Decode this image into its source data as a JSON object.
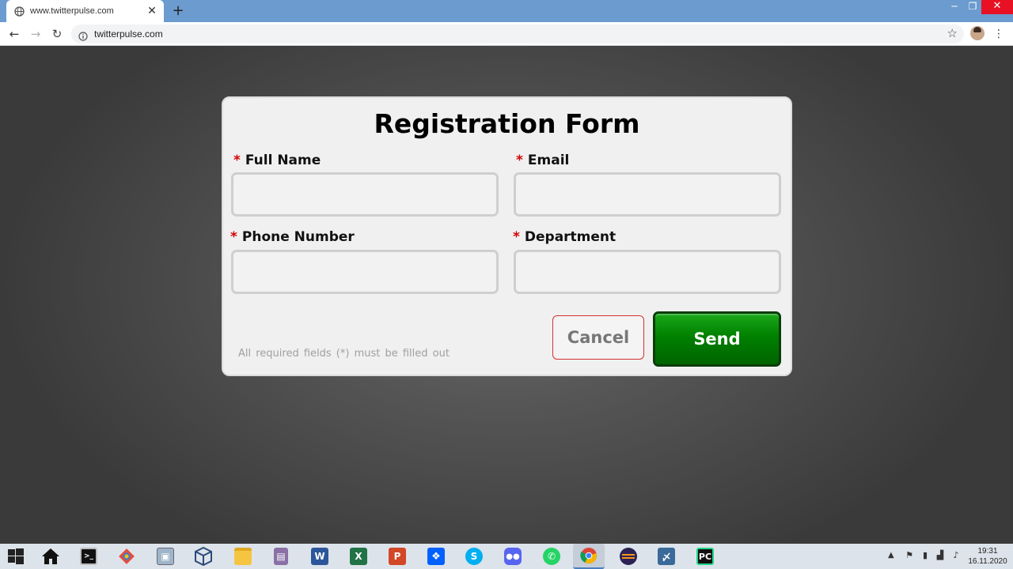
{
  "browser": {
    "tab_title": "www.twitterpulse.com",
    "new_tab_glyph": "+",
    "url": "twitterpulse.com"
  },
  "form": {
    "title": "Registration Form",
    "required_marker": "*",
    "fields": {
      "full_name": {
        "label": "Full  Name",
        "value": ""
      },
      "email": {
        "label": "Email",
        "value": ""
      },
      "phone": {
        "label": "Phone Number",
        "value": ""
      },
      "department": {
        "label": "Department",
        "value": ""
      }
    },
    "note": "All required  fields  (*) must  be  filled  out",
    "cancel_label": "Cancel",
    "send_label": "Send"
  },
  "taskbar": {
    "apps": [
      "windows-start-icon",
      "home-icon",
      "terminal-icon",
      "git-icon",
      "image-viewer-icon",
      "virtualbox-icon",
      "file-explorer-icon",
      "archive-icon",
      "word-icon",
      "excel-icon",
      "powerpoint-icon",
      "dropbox-icon",
      "skype-icon",
      "discord-icon",
      "whatsapp-icon",
      "chrome-icon",
      "eclipse-icon",
      "mysql-workbench-icon",
      "pycharm-icon"
    ],
    "time": "19:31",
    "date": "16.11.2020"
  },
  "colors": {
    "send_button": "#008000",
    "cancel_border": "#d43030",
    "required_marker": "#d40000",
    "tabstrip": "#6b9bcf"
  }
}
